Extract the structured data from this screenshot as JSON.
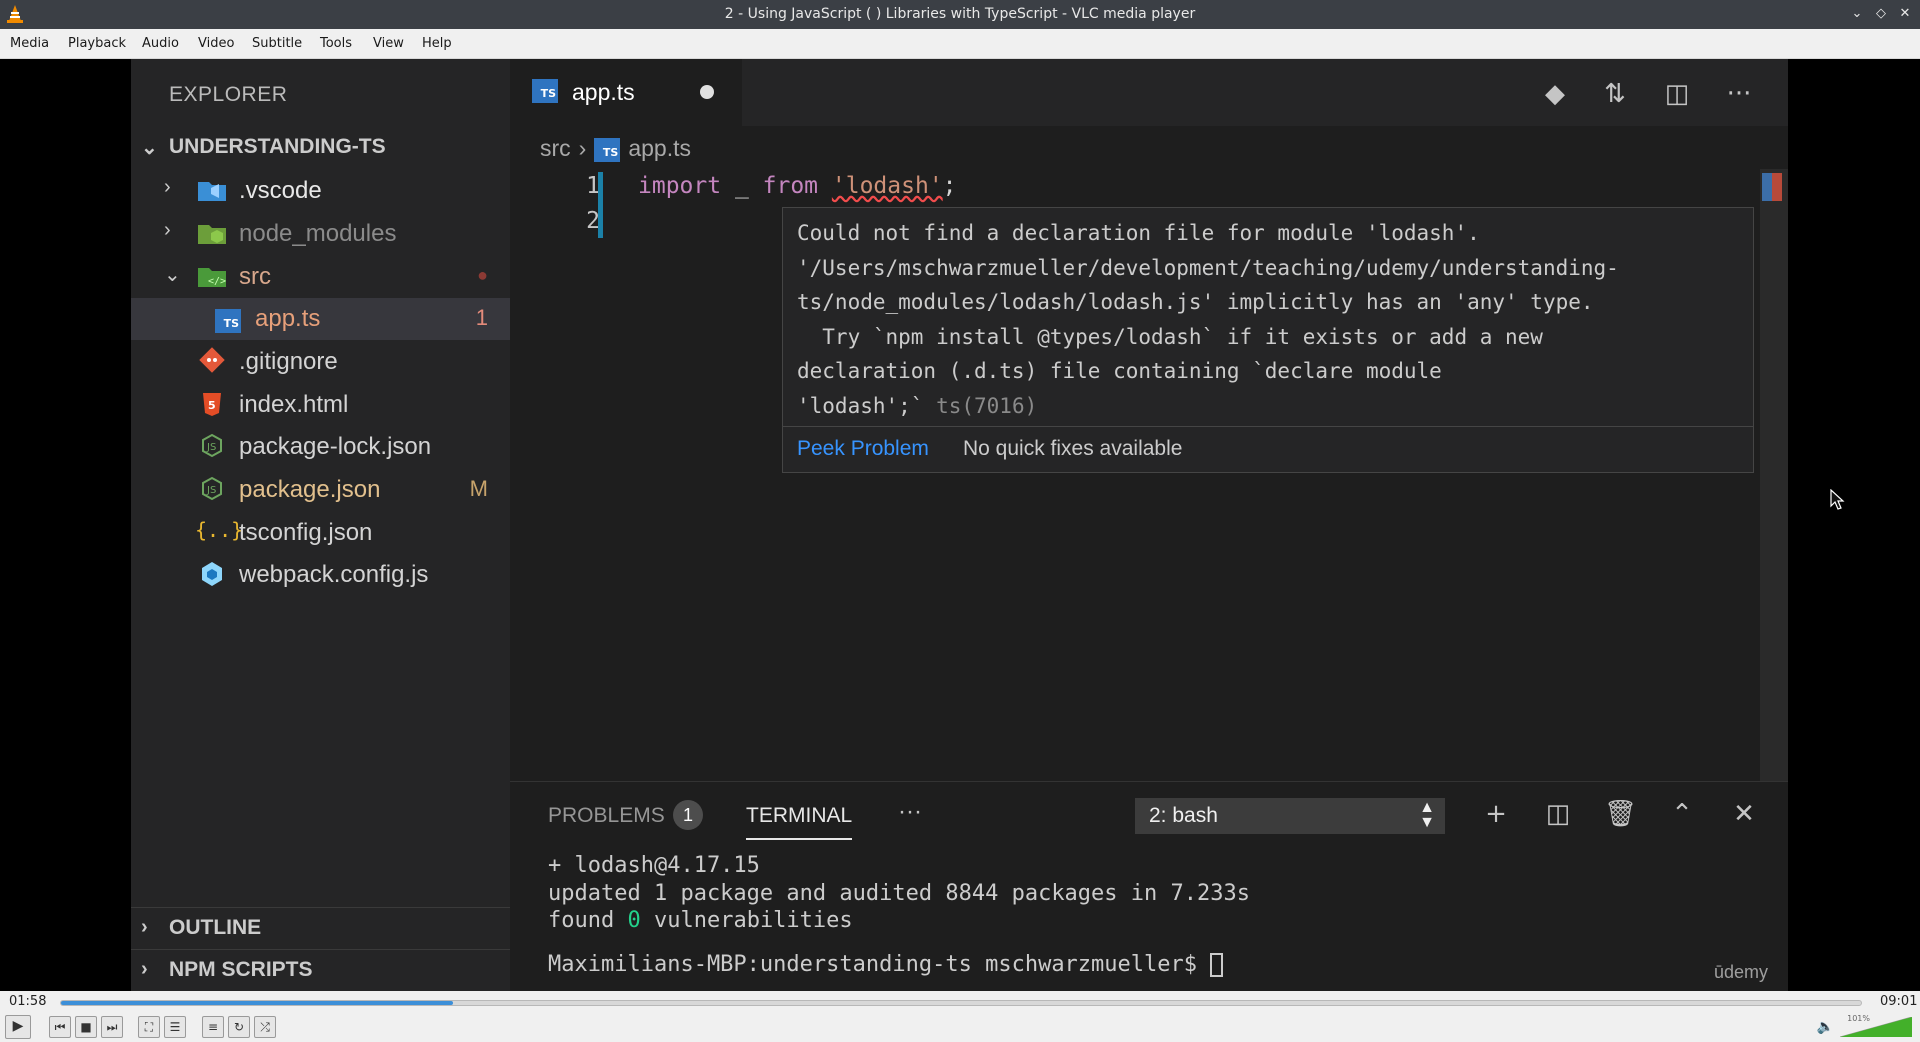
{
  "window": {
    "title": "2 - Using JavaScript ( ) Libraries with TypeScript - VLC media player",
    "controls": [
      "minimize",
      "restore",
      "close"
    ]
  },
  "menu": [
    "Media",
    "Playback",
    "Audio",
    "Video",
    "Subtitle",
    "Tools",
    "View",
    "Help"
  ],
  "explorer": {
    "title": "EXPLORER",
    "project": "UNDERSTANDING-TS",
    "items": [
      {
        "name": ".vscode",
        "icon": "vscode-folder-icon",
        "badge": ""
      },
      {
        "name": "node_modules",
        "icon": "node-folder-icon",
        "badge": ""
      },
      {
        "name": "src",
        "icon": "src-folder-icon",
        "badge": "●"
      },
      {
        "name": "app.ts",
        "icon": "ts-file-icon",
        "badge": "1"
      },
      {
        "name": ".gitignore",
        "icon": "git-icon",
        "badge": ""
      },
      {
        "name": "index.html",
        "icon": "html5-icon",
        "badge": ""
      },
      {
        "name": "package-lock.json",
        "icon": "node-json-icon",
        "badge": ""
      },
      {
        "name": "package.json",
        "icon": "node-json-icon",
        "badge": "M"
      },
      {
        "name": "tsconfig.json",
        "icon": "json-braces-icon",
        "badge": ""
      },
      {
        "name": "webpack.config.js",
        "icon": "webpack-icon",
        "badge": ""
      }
    ],
    "sections": [
      "OUTLINE",
      "NPM SCRIPTS"
    ]
  },
  "editor": {
    "tab_label": "app.ts",
    "ts_badge": "TS",
    "breadcrumb": [
      "src",
      "app.ts"
    ],
    "line_numbers": [
      "1",
      "2"
    ],
    "code": {
      "import_kw": "import",
      "ident": " _ ",
      "from_kw": "from",
      "module": "'lodash'",
      "semi": ";"
    },
    "hover": {
      "lines": [
        "Could not find a declaration file for module 'lodash'.",
        "'/Users/mschwarzmueller/development/teaching/udemy/understanding-",
        "ts/node_modules/lodash/lodash.js' implicitly has an 'any' type.",
        "  Try `npm install @types/lodash` if it exists or add a new",
        "declaration (.d.ts) file containing `declare module",
        "'lodash';`"
      ],
      "code": "ts(7016)",
      "peek": "Peek Problem",
      "no_fix": "No quick fixes available"
    }
  },
  "panel": {
    "problems_label": "PROBLEMS",
    "problems_count": "1",
    "terminal_label": "TERMINAL",
    "more": "···",
    "shell": "2: bash",
    "terminal_lines": {
      "l1": "+ lodash@4.17.15",
      "l2": "updated 1 package and audited 8844 packages in 7.233s",
      "l3a": "found ",
      "l3b": "0",
      "l3c": " vulnerabilities",
      "prompt": "Maximilians-MBP:understanding-ts mschwarzmueller$ "
    },
    "watermark": "ūdemy"
  },
  "player": {
    "elapsed": "01:58",
    "total": "09:01",
    "progress_fraction": 0.218,
    "volume_label": "101%",
    "volume_fraction": 1.0,
    "accent": "#3c8fd8"
  }
}
